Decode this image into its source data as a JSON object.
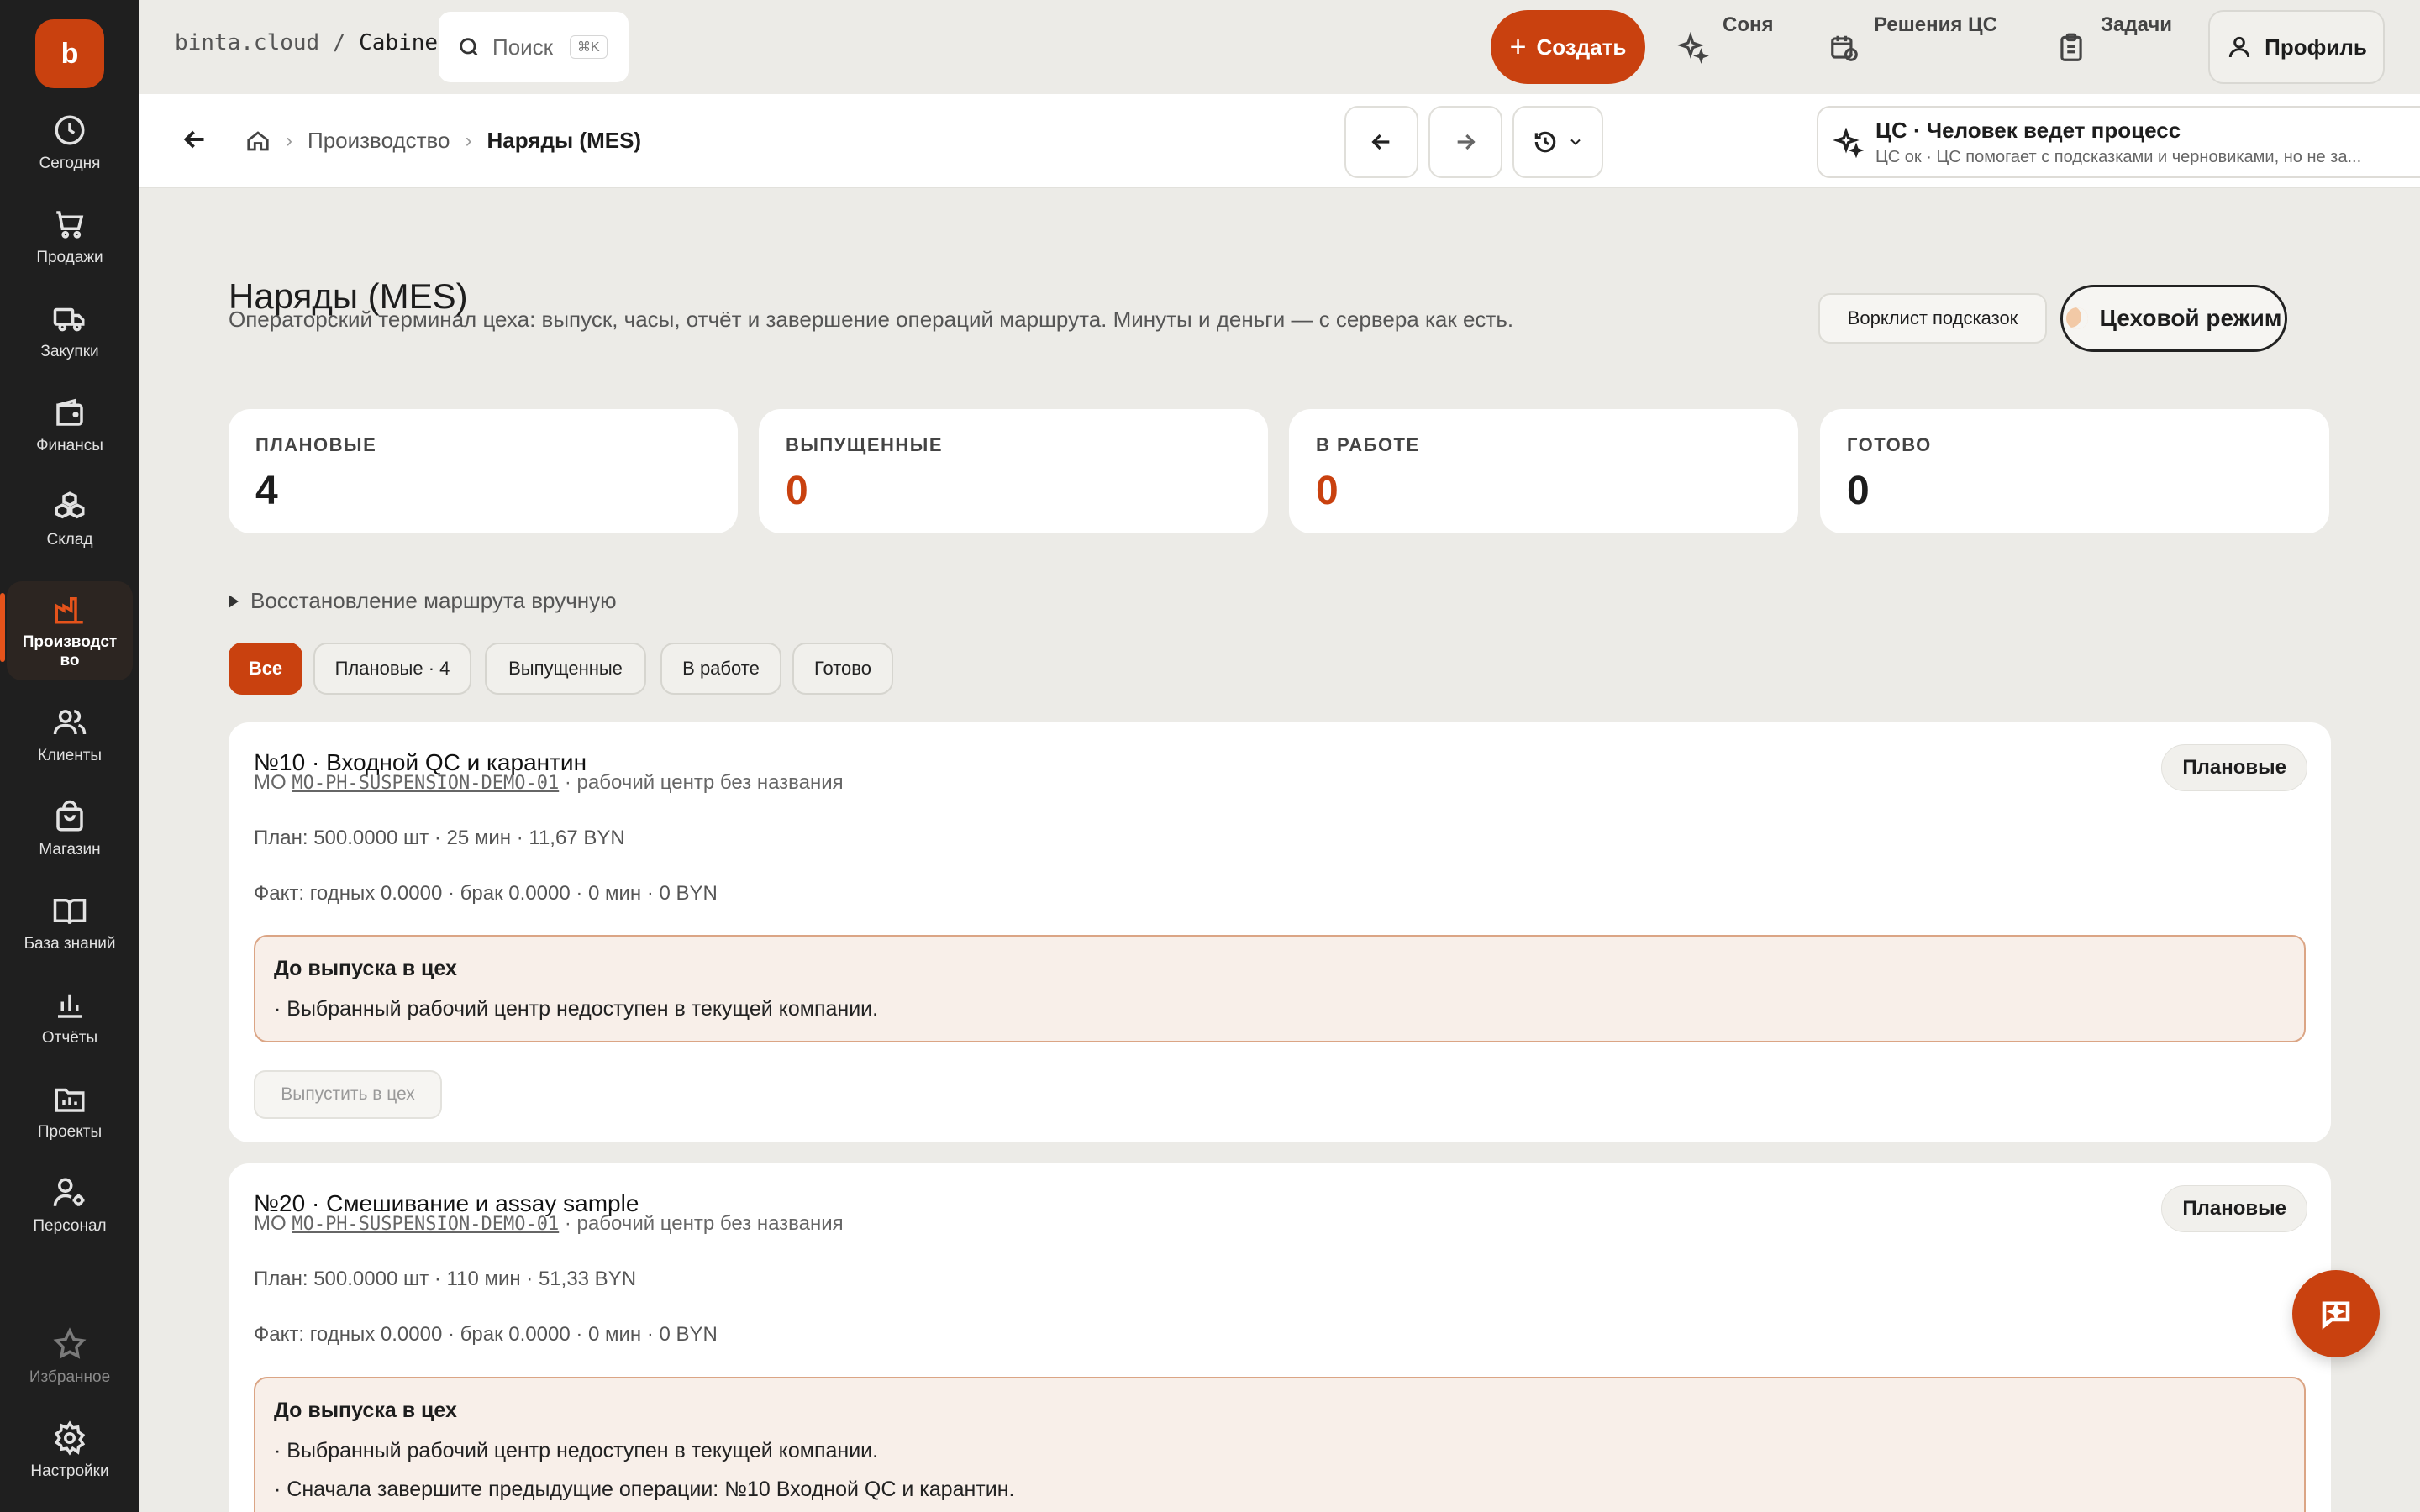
{
  "sidebar": {
    "logo": "b",
    "items": [
      {
        "label": "Сегодня",
        "icon": "clock-icon"
      },
      {
        "label": "Продажи",
        "icon": "cart-icon"
      },
      {
        "label": "Закупки",
        "icon": "truck-icon"
      },
      {
        "label": "Финансы",
        "icon": "wallet-icon"
      },
      {
        "label": "Склад",
        "icon": "boxes-icon"
      },
      {
        "label": "Производст во",
        "icon": "factory-icon",
        "active": true
      },
      {
        "label": "Клиенты",
        "icon": "users-icon"
      },
      {
        "label": "Магазин",
        "icon": "bag-icon"
      },
      {
        "label": "База знаний",
        "icon": "book-icon"
      },
      {
        "label": "Отчёты",
        "icon": "bar-chart-icon"
      },
      {
        "label": "Проекты",
        "icon": "folder-icon"
      },
      {
        "label": "Персонал",
        "icon": "user-gear-icon"
      }
    ],
    "bottom": [
      {
        "label": "Избранное",
        "icon": "star-icon"
      },
      {
        "label": "Настройки",
        "icon": "gear-icon"
      }
    ]
  },
  "topbar": {
    "workspace_host": "binta.cloud",
    "workspace_sep": " / ",
    "workspace_name": "Cabinet",
    "search_placeholder": "Поиск",
    "search_shortcut": "⌘K",
    "create_label": "Создать",
    "links": [
      {
        "label": "Соня",
        "icon": "sparkle-icon"
      },
      {
        "label": "Решения ЦС",
        "icon": "calendar-clock-icon"
      },
      {
        "label": "Задачи",
        "icon": "clipboard-icon"
      }
    ],
    "profile_label": "Профиль"
  },
  "subheader": {
    "crumbs": [
      "Производство",
      "Наряды (MES)"
    ],
    "cs_title": "ЦС · Человек ведет процесс",
    "cs_subtitle": "ЦС ок · ЦС помогает с подсказками и черновиками, но не за..."
  },
  "main": {
    "title": "Наряды (MES)",
    "description": "Операторский терминал цеха: выпуск, часы, отчёт и завершение операций маршрута. Минуты и деньги — с сервера как есть.",
    "hint_button": "Ворклист подсказок",
    "shop_mode_button": "Цеховой режим",
    "stats": [
      {
        "label": "ПЛАНОВЫЕ",
        "value": "4"
      },
      {
        "label": "ВЫПУЩЕННЫЕ",
        "value": "0"
      },
      {
        "label": "В РАБОТЕ",
        "value": "0"
      },
      {
        "label": "ГОТОВО",
        "value": "0"
      }
    ],
    "restore_label": "Восстановление маршрута вручную",
    "filters": [
      "Все",
      "Плановые · 4",
      "Выпущенные",
      "В работе",
      "Готово"
    ],
    "cards": [
      {
        "title": "№10 · Входной QC и карантин",
        "mo_prefix": "МО ",
        "mo_code": "MO-PH-SUSPENSION-DEMO-01",
        "mo_suffix": " · рабочий центр без названия",
        "plan": "План: 500.0000 шт · 25 мин · 11,67 BYN",
        "fact": "Факт: годных 0.0000 · брак 0.0000 · 0 мин · 0 BYN",
        "badge": "Плановые",
        "warn_title": "До выпуска в цех",
        "warn_lines": [
          "· Выбранный рабочий центр недоступен в текущей компании."
        ],
        "release_label": "Выпустить в цех"
      },
      {
        "title": "№20 · Смешивание и assay sample",
        "mo_prefix": "МО ",
        "mo_code": "MO-PH-SUSPENSION-DEMO-01",
        "mo_suffix": " · рабочий центр без названия",
        "plan": "План: 500.0000 шт · 110 мин · 51,33 BYN",
        "fact": "Факт: годных 0.0000 · брак 0.0000 · 0 мин · 0 BYN",
        "badge": "Плановые",
        "warn_title": "До выпуска в цех",
        "warn_lines": [
          "· Выбранный рабочий центр недоступен в текущей компании.",
          "· Сначала завершите предыдущие операции: №10 Входной QC и карантин."
        ]
      }
    ]
  },
  "colors": {
    "accent": "#c9410f",
    "sidebar": "#1f1f1f",
    "background": "#ecebe7"
  }
}
